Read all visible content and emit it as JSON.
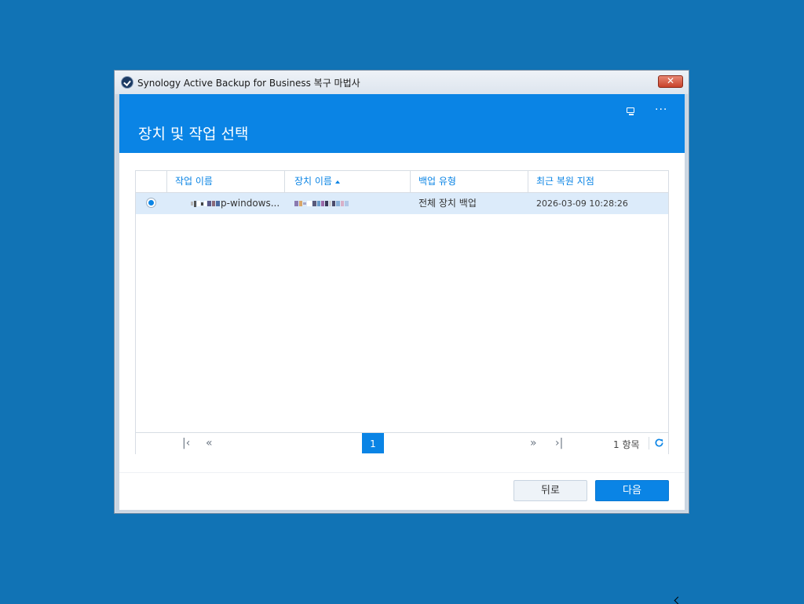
{
  "colors": {
    "desktop": "#1173b5",
    "accent": "#0a84e5",
    "selected_row": "#dcebfa",
    "close_button": "#c8412a"
  },
  "window": {
    "title": "Synology Active Backup for Business 복구 마법사",
    "icon": "synology-check-icon",
    "close_label": "✕"
  },
  "header": {
    "title": "장치 및 작업 선택",
    "icons": [
      "monitor-icon",
      "more-icon"
    ],
    "more_label": "···"
  },
  "table": {
    "columns": [
      "작업 이름",
      "장치 이름",
      "백업 유형",
      "최근 복원 지점"
    ],
    "sort_column": "장치 이름",
    "sort_direction": "ascending",
    "rows": [
      {
        "selected": true,
        "task_name": "p-windows...",
        "device_name": "",
        "backup_type": "전체 장치 백업",
        "last_restore_point": "2026-03-09 10:28:26"
      }
    ]
  },
  "pager": {
    "current_page": "1",
    "total_items": "1 항목"
  },
  "footer": {
    "back_label": "뒤로",
    "next_label": "다음"
  }
}
